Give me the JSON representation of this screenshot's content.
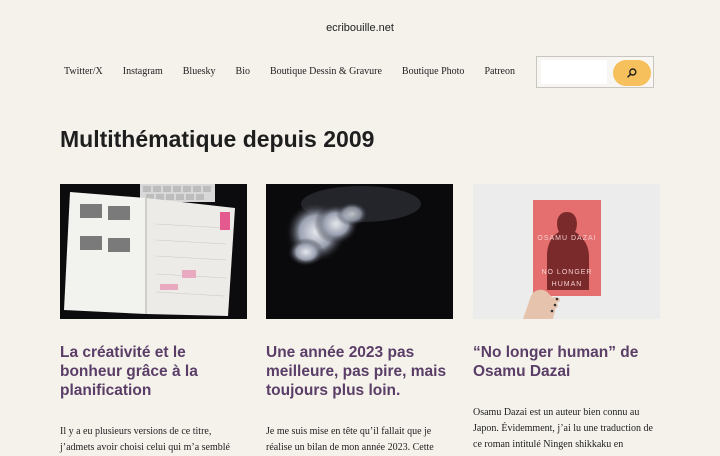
{
  "site": {
    "title": "ecribouille.net"
  },
  "nav": {
    "items": [
      {
        "label": "Twitter/X"
      },
      {
        "label": "Instagram"
      },
      {
        "label": "Bluesky"
      },
      {
        "label": "Bio"
      },
      {
        "label": "Boutique Dessin & Gravure"
      },
      {
        "label": "Boutique Photo"
      },
      {
        "label": "Patreon"
      }
    ]
  },
  "search": {
    "value": "",
    "icon": "search-icon"
  },
  "page": {
    "title": "Multithématique depuis 2009"
  },
  "posts": [
    {
      "title": "La créativité et le bonheur grâce à la planification",
      "excerpt": "Il y a eu plusieurs versions de ce titre, j’admets avoir choisi celui qui m’a semblé",
      "image": "notebook-planner-image"
    },
    {
      "title": "Une année 2023 pas meilleure, pas pire, mais toujours plus loin.",
      "excerpt": "Je me suis mise en tête qu’il fallait que je réalise un bilan de mon année 2023. Cette",
      "image": "cloud-dark-sky-image"
    },
    {
      "title": "“No longer human” de Osamu Dazai",
      "excerpt": "Osamu Dazai est un auteur bien connu au Japon. Évidemment, j’ai lu une traduction de ce roman intitulé Ningen shikkaku en",
      "image": "book-cover-image",
      "book_text": {
        "author": "OSAMU DAZAI",
        "title_line1": "NO LONGER",
        "title_line2": "HUMAN"
      }
    }
  ],
  "colors": {
    "background": "#f5f2ec",
    "accent": "#f6c05c",
    "post_title": "#5a3e67"
  }
}
